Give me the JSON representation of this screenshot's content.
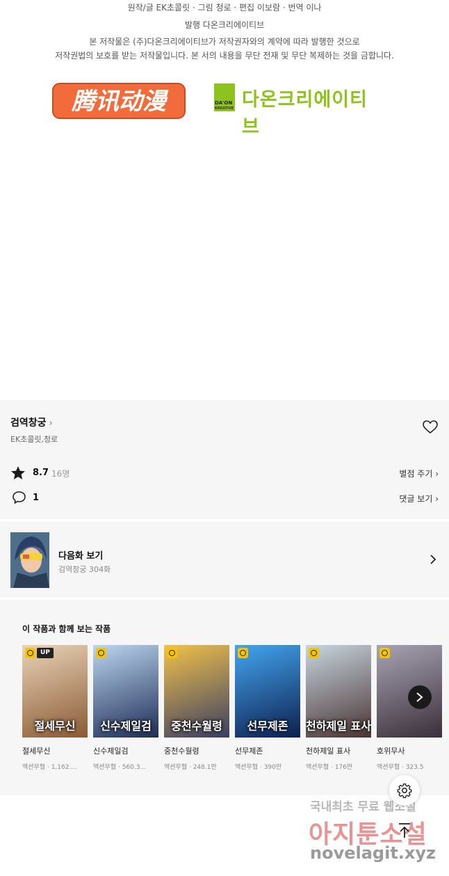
{
  "credits": {
    "line1": "원작/글 EK초콜릿 · 그림 청로 · 편집 이보람 · 번역 이나",
    "line2": "발행 다온크리에이티브",
    "line3": "본 저작물은 (주)다온크리에이티브가 저작권자와의 계약에 따라 발행한 것으로",
    "line4": "저작권법의 보호를 받는 저작물입니다. 본 서의 내용을 무단 전재 및 무단 복제하는 것을 금합니다."
  },
  "logos": {
    "tencent_text": "腾讯动漫",
    "daon_mark_top": "DA'ON",
    "daon_mark_bottom": "KREATIVE",
    "daon_name": "다온크리에이티브"
  },
  "work": {
    "title": "검역창궁",
    "title_chevron": "›",
    "authors": "EK초콜릿,청로",
    "rating_value": "8.7",
    "rating_count": "16명",
    "rating_link": "별점 주기 ›",
    "comment_count": "1",
    "comment_link": "댓글 보기 ›"
  },
  "next_episode": {
    "title": "다음화 보기",
    "subtitle": "검역창궁 304화"
  },
  "recommendations": {
    "heading": "이 작품과 함께 보는 작품",
    "items": [
      {
        "name": "절세무신",
        "meta": "액션무협 · 1,162....",
        "badge": "UP",
        "cover_text": "절세무신",
        "colors": [
          "#e9d4b8",
          "#8a5a34"
        ]
      },
      {
        "name": "신수제일검",
        "meta": "액션무협 · 560.3...",
        "badge": "",
        "cover_text": "신수제일검",
        "colors": [
          "#bcd6f0",
          "#1d2c55"
        ]
      },
      {
        "name": "중천수월령",
        "meta": "액션무협 · 248.1만",
        "badge": "",
        "cover_text": "중천수월령",
        "colors": [
          "#f2c14a",
          "#3b3f62"
        ]
      },
      {
        "name": "선무제존",
        "meta": "액션무협 · 390만",
        "badge": "",
        "cover_text": "선무제존",
        "colors": [
          "#43a6f0",
          "#0d1f4d"
        ]
      },
      {
        "name": "천하제일 표사",
        "meta": "액션무협 · 176만",
        "badge": "",
        "cover_text": "천하제일 표사",
        "colors": [
          "#c7d6df",
          "#4a3434"
        ]
      },
      {
        "name": "호위무사",
        "meta": "액션무협 · 323.5",
        "badge": "",
        "cover_text": "",
        "colors": [
          "#a8a4b4",
          "#3a2f3a"
        ]
      }
    ]
  },
  "watermark": {
    "line1": "국내최초 무료 웹소설",
    "line2": "아지툰소설",
    "line3": "novelagit.xyz"
  }
}
